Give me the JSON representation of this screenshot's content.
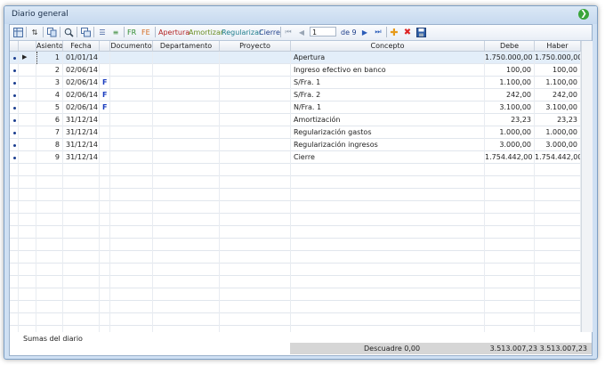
{
  "window": {
    "title": "Diario general"
  },
  "toolbar": {
    "fr_label": "FR",
    "fe_label": "FE",
    "apertura_label": "Apertura",
    "amortizar_label": "Amortizar",
    "regularizar_label": "Regularizar",
    "cierre_label": "Cierre",
    "page_value": "1",
    "page_of_label": "de 9"
  },
  "columns": {
    "asiento": "Asiento",
    "fecha": "Fecha",
    "documento": "Documento",
    "departamento": "Departamento",
    "proyecto": "Proyecto",
    "concepto": "Concepto",
    "debe": "Debe",
    "haber": "Haber"
  },
  "rows": [
    {
      "asiento": "1",
      "fecha": "01/01/14",
      "flag": "",
      "concepto": "Apertura",
      "debe": "1.750.000,00",
      "haber": "1.750.000,00"
    },
    {
      "asiento": "2",
      "fecha": "02/06/14",
      "flag": "",
      "concepto": "Ingreso efectivo en banco",
      "debe": "100,00",
      "haber": "100,00"
    },
    {
      "asiento": "3",
      "fecha": "02/06/14",
      "flag": "F",
      "concepto": "S/Fra. 1",
      "debe": "1.100,00",
      "haber": "1.100,00"
    },
    {
      "asiento": "4",
      "fecha": "02/06/14",
      "flag": "F",
      "concepto": "S/Fra. 2",
      "debe": "242,00",
      "haber": "242,00"
    },
    {
      "asiento": "5",
      "fecha": "02/06/14",
      "flag": "F",
      "concepto": "N/Fra. 1",
      "debe": "3.100,00",
      "haber": "3.100,00"
    },
    {
      "asiento": "6",
      "fecha": "31/12/14",
      "flag": "",
      "concepto": "Amortización",
      "debe": "23,23",
      "haber": "23,23"
    },
    {
      "asiento": "7",
      "fecha": "31/12/14",
      "flag": "",
      "concepto": "Regularización gastos",
      "debe": "1.000,00",
      "haber": "1.000,00"
    },
    {
      "asiento": "8",
      "fecha": "31/12/14",
      "flag": "",
      "concepto": "Regularización ingresos",
      "debe": "3.000,00",
      "haber": "3.000,00"
    },
    {
      "asiento": "9",
      "fecha": "31/12/14",
      "flag": "",
      "concepto": "Cierre",
      "debe": "1.754.442,00",
      "haber": "1.754.442,00"
    }
  ],
  "footer": {
    "label": "Sumas del diario",
    "descuadre": "Descuadre 0,00",
    "total_debe": "3.513.007,23",
    "total_haber": "3.513.007,23"
  },
  "colors": {
    "fr": "#2e8b2e",
    "fe": "#d2691e",
    "apertura": "#b22222",
    "amortizar": "#6b8e23",
    "regularizar": "#1e7d8c",
    "cierre": "#1f3f8a",
    "flag": "#1a3dbf"
  },
  "icons": [
    "grid-icon",
    "sort-icon",
    "copy-icon",
    "search-icon",
    "multi-window-icon",
    "list-icon",
    "list-add-icon",
    "first-page-icon",
    "prev-page-icon",
    "next-page-icon",
    "last-page-icon",
    "add-icon",
    "delete-icon",
    "save-icon",
    "green-action-icon",
    "row-pointer-icon"
  ]
}
